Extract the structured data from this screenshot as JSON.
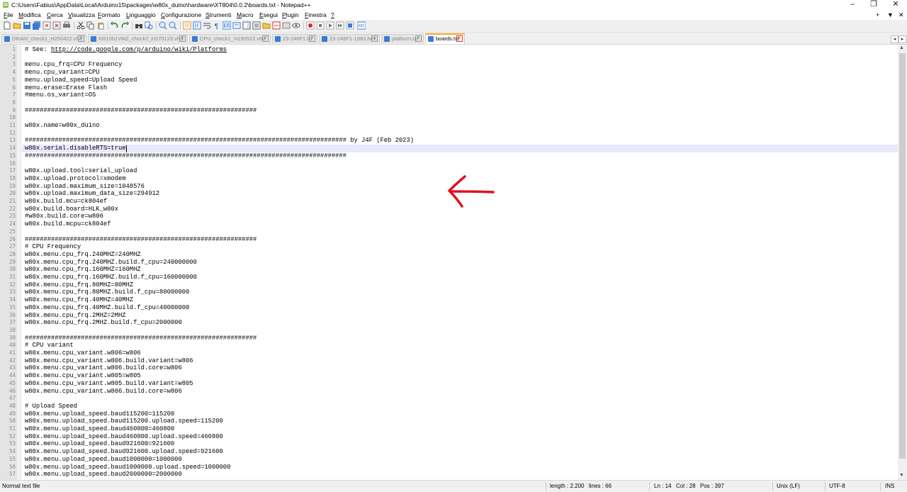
{
  "window": {
    "title": "C:\\Users\\Fabius\\AppData\\Local\\Arduino15\\packages\\w80x_duino\\hardware\\XT804\\0.0.2\\boards.txt - Notepad++",
    "minimize": "–",
    "restore": "❐",
    "close": "✕"
  },
  "menu": {
    "items": [
      {
        "first": "F",
        "rest": "ile"
      },
      {
        "first": "M",
        "rest": "odifica"
      },
      {
        "first": "C",
        "rest": "erca"
      },
      {
        "first": "V",
        "rest": "isualizza"
      },
      {
        "first": "F",
        "rest": "ormato"
      },
      {
        "first": "L",
        "rest": "inguaggio"
      },
      {
        "first": "C",
        "rest": "onfigurazione"
      },
      {
        "first": "S",
        "rest": "trumenti"
      },
      {
        "first": "M",
        "rest": "acro"
      },
      {
        "first": "E",
        "rest": "segui"
      },
      {
        "first": "P",
        "rest": "lugin"
      },
      {
        "first": "F",
        "rest": "inestra"
      },
      {
        "first": "?",
        "rest": ""
      }
    ],
    "right_plus": "+",
    "right_down": "▼",
    "right_close": "✕"
  },
  "tabs": [
    {
      "label": "DRAM_check1_H250422.vhd",
      "active": false
    },
    {
      "label": "KR1001VM2_check2_H270123.vhd",
      "active": false
    },
    {
      "label": "CPU_check1_H190522.vhd",
      "active": false
    },
    {
      "label": "23-248F1.lst",
      "active": false
    },
    {
      "label": "23-248F1-1983.hex",
      "active": false
    },
    {
      "label": "platform.txt",
      "active": false
    },
    {
      "label": "boards.txt",
      "active": true
    }
  ],
  "tab_nav": {
    "left": "◂",
    "right": "▸"
  },
  "tab_close": "x",
  "editor": {
    "current_line": 14,
    "lines": [
      "# See: http://code.google.com/p/arduino/wiki/Platforms",
      "",
      "menu.cpu_frq=CPU Frequency",
      "menu.cpu_variant=CPU",
      "menu.upload_speed=Upload Speed",
      "menu.erase=Erase Flash",
      "#menu.os_variant=OS",
      "",
      "##############################################################",
      "",
      "w80x.name=w80x_duino",
      "",
      "###################################################################################### by J4F (Feb 2023)",
      "w80x.serial.disableRTS=true",
      "######################################################################################",
      "",
      "w80x.upload.tool=serial_upload",
      "w80x.upload.protocol=xmodem",
      "w80x.upload.maximum_size=1048576",
      "w80x.upload.maximum_data_size=294912",
      "w80x.build.mcu=ck804ef",
      "w80x.build.board=HLK_w80x",
      "#w80x.build.core=w806",
      "w80x.build.mcpu=ck804ef",
      "",
      "##############################################################",
      "# CPU Frequency",
      "w80x.menu.cpu_frq.240MHZ=240MHZ",
      "w80x.menu.cpu_frq.240MHZ.build.f_cpu=240000000",
      "w80x.menu.cpu_frq.160MHZ=160MHZ",
      "w80x.menu.cpu_frq.160MHZ.build.f_cpu=160000000",
      "w80x.menu.cpu_frq.80MHZ=80MHZ",
      "w80x.menu.cpu_frq.80MHZ.build.f_cpu=80000000",
      "w80x.menu.cpu_frq.40MHZ=40MHZ",
      "w80x.menu.cpu_frq.40MHZ.build.f_cpu=40000000",
      "w80x.menu.cpu_frq.2MHZ=2MHZ",
      "w80x.menu.cpu_frq.2MHZ.build.f_cpu=2000000",
      "",
      "##############################################################",
      "# CPU variant",
      "w80x.menu.cpu_variant.w806=w806",
      "w80x.menu.cpu_variant.w806.build.variant=w806",
      "w80x.menu.cpu_variant.w806.build.core=w806",
      "w80x.menu.cpu_variant.w805=w805",
      "w80x.menu.cpu_variant.w805.build.variant=w805",
      "w80x.menu.cpu_variant.w806.build.core=w806",
      "",
      "# Upload Speed",
      "w80x.menu.upload_speed.baud115200=115200",
      "w80x.menu.upload_speed.baud115200.upload.speed=115200",
      "w80x.menu.upload_speed.baud460800=460800",
      "w80x.menu.upload_speed.baud460800.upload.speed=460800",
      "w80x.menu.upload_speed.baud921600=921600",
      "w80x.menu.upload_speed.baud921600.upload.speed=921600",
      "w80x.menu.upload_speed.baud1000000=1000000",
      "w80x.menu.upload_speed.baud1000000.upload.speed=1000000",
      "w80x.menu.upload_speed.baud2000000=2000000"
    ]
  },
  "annotation": {
    "color": "#e3101e"
  },
  "colors": {
    "caret_line": "#e8e8ff",
    "active_tab_accent": "#f9a825"
  },
  "status": {
    "file_type": "Normal text file",
    "length": "length : 2.200",
    "lines": "lines : 66",
    "ln": "Ln : 14",
    "col": "Col : 28",
    "pos": "Pos : 397",
    "eol": "Unix (LF)",
    "encoding": "UTF-8",
    "mode": "INS"
  }
}
